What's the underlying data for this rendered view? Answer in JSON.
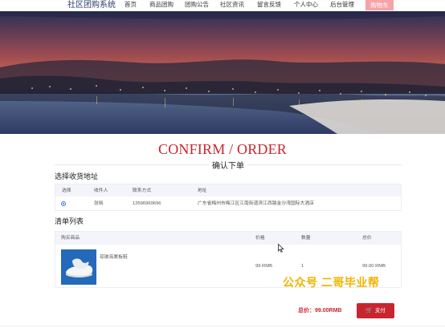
{
  "nav": {
    "brand": "社区团购系统",
    "items": [
      "首页",
      "商品团购",
      "团购公告",
      "社区资讯",
      "留言反馈",
      "个人中心",
      "后台管理"
    ],
    "cart": "购物车"
  },
  "heading": {
    "title": "CONFIRM / ORDER",
    "subtitle": "确认下单"
  },
  "address_section": {
    "title": "选择收货地址",
    "columns": [
      "选择",
      "收件人",
      "联系方式",
      "地址"
    ],
    "rows": [
      {
        "selected": true,
        "name": "张晓",
        "phone": "13596969696",
        "address": "广东省梅州市梅江区江南街道滨江西路金沙湾国际大酒店"
      }
    ]
  },
  "order_section": {
    "title": "清单列表",
    "columns": [
      "购买商品",
      "价格",
      "数量",
      "总价"
    ],
    "items": [
      {
        "name": "琼玻亮裹板鞋",
        "price": "99 RMB",
        "qty": "1",
        "total": "99.00 RMB"
      }
    ]
  },
  "footer": {
    "total_label": "总价：99.00RMB",
    "pay_label": "支付"
  },
  "watermark": "公众号  二哥毕业帮",
  "colors": {
    "accent": "#c8262e",
    "nav_cart": "#f5a3a8",
    "brand": "#2a3a6b"
  }
}
